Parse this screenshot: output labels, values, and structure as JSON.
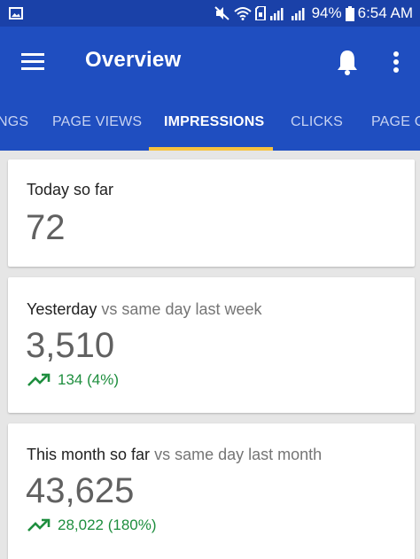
{
  "status_bar": {
    "battery": "94%",
    "time": "6:54 AM"
  },
  "app_bar": {
    "title": "Overview"
  },
  "tabs": [
    {
      "label": "NGS"
    },
    {
      "label": "PAGE VIEWS"
    },
    {
      "label": "IMPRESSIONS",
      "active": true
    },
    {
      "label": "CLICKS"
    },
    {
      "label": "PAGE C"
    }
  ],
  "cards": [
    {
      "label": "Today so far",
      "comparison": "",
      "value": "72",
      "change": ""
    },
    {
      "label": "Yesterday",
      "comparison": "vs same day last week",
      "value": "3,510",
      "change": "134 (4%)"
    },
    {
      "label": "This month so far",
      "comparison": "vs same day last month",
      "value": "43,625",
      "change": "28,022 (180%)"
    }
  ],
  "colors": {
    "app_bar": "#1f4ec0",
    "status_bar": "#1a41a8",
    "tab_indicator": "#f6c23e",
    "positive_change": "#1e8e3e"
  }
}
